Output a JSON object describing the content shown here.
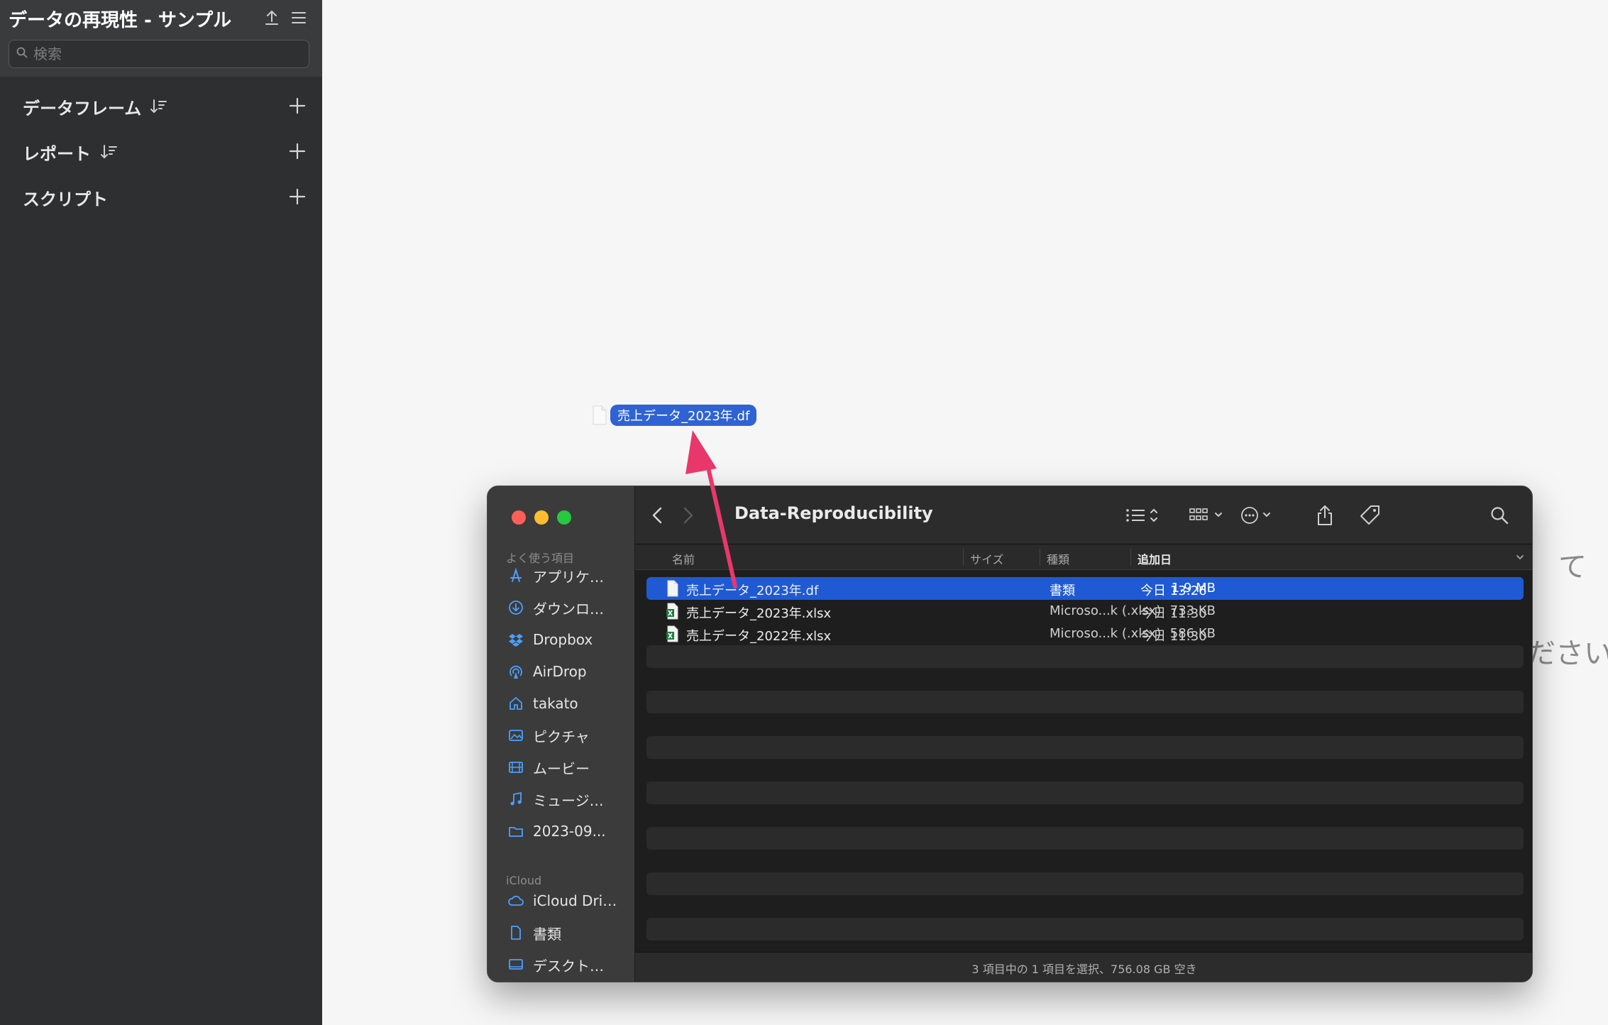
{
  "app": {
    "title": "データの再現性 - サンプル",
    "search_placeholder": "検索",
    "sections": [
      {
        "label": "データフレーム"
      },
      {
        "label": "レポート"
      },
      {
        "label": "スクリプト"
      }
    ]
  },
  "hint": {
    "line1_fragment": "て",
    "line2_fragment": "ださい"
  },
  "drag": {
    "file_label": "売上データ_2023年.df"
  },
  "finder": {
    "title": "Data-Reproducibility",
    "sidebar": {
      "favorites_heading": "よく使う項目",
      "favorites": [
        {
          "label": "アプリケ…",
          "icon": "applications-icon"
        },
        {
          "label": "ダウンロ…",
          "icon": "downloads-icon"
        },
        {
          "label": "Dropbox",
          "icon": "dropbox-icon"
        },
        {
          "label": "AirDrop",
          "icon": "airdrop-icon"
        },
        {
          "label": "takato",
          "icon": "home-icon"
        },
        {
          "label": "ピクチャ",
          "icon": "pictures-icon"
        },
        {
          "label": "ムービー",
          "icon": "movies-icon"
        },
        {
          "label": "ミュージ…",
          "icon": "music-icon"
        },
        {
          "label": "2023-09...",
          "icon": "folder-icon"
        }
      ],
      "icloud_heading": "iCloud",
      "icloud": [
        {
          "label": "iCloud Dri…",
          "icon": "icloud-icon"
        },
        {
          "label": "書類",
          "icon": "document-icon"
        },
        {
          "label": "デスクト…",
          "icon": "desktop-icon"
        }
      ]
    },
    "columns": {
      "name": "名前",
      "size": "サイズ",
      "kind": "種類",
      "date_added": "追加日"
    },
    "files": [
      {
        "name": "売上データ_2023年.df",
        "size": "1.9 MB",
        "kind": "書類",
        "date": "今日 13:26",
        "selected": true,
        "icon": "document-icon"
      },
      {
        "name": "売上データ_2023年.xlsx",
        "size": "733 KB",
        "kind": "Microso...k (.xlsx)",
        "date": "今日 11:30",
        "selected": false,
        "icon": "excel-icon"
      },
      {
        "name": "売上データ_2022年.xlsx",
        "size": "586 KB",
        "kind": "Microso...k (.xlsx)",
        "date": "今日 11:30",
        "selected": false,
        "icon": "excel-icon"
      }
    ],
    "status": "3 項目中の 1 項目を選択、756.08 GB 空き"
  },
  "colors": {
    "accent": "#1f5ad4",
    "drag_arrow": "#e8386b"
  }
}
